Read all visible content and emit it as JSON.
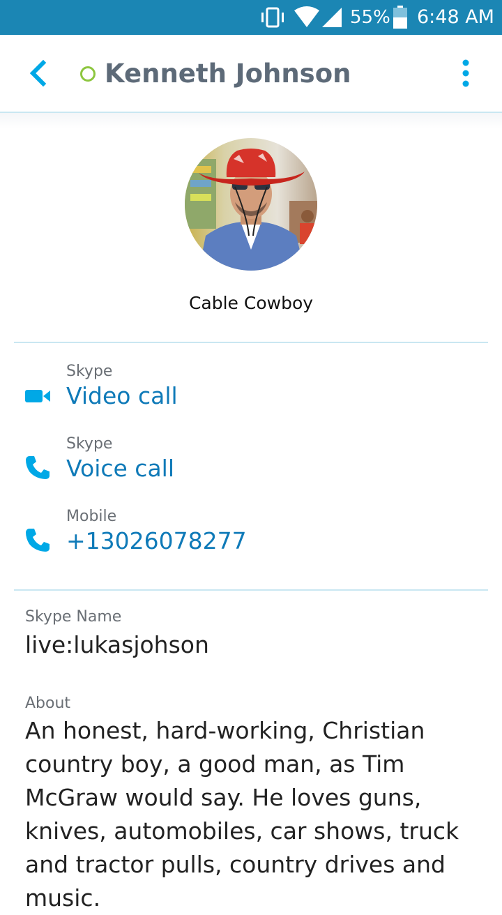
{
  "status_bar": {
    "battery_percent": "55%",
    "time": "6:48 AM",
    "icons": [
      "vibrate-icon",
      "wifi-icon",
      "signal-icon",
      "battery-icon"
    ]
  },
  "header": {
    "title": "Kenneth Johnson",
    "presence": "offline",
    "accent_color": "#00a8e6",
    "presence_color": "#8dc63f"
  },
  "profile": {
    "mood": "Cable Cowboy"
  },
  "contact_methods": [
    {
      "label": "Skype",
      "value": "Video call",
      "icon": "video-camera-icon"
    },
    {
      "label": "Skype",
      "value": "Voice call",
      "icon": "phone-icon"
    },
    {
      "label": "Mobile",
      "value": "+13026078277",
      "icon": "phone-icon"
    }
  ],
  "details": {
    "skype_name_label": "Skype Name",
    "skype_name": "live:lukasjohson",
    "about_label": "About",
    "about_text": "An honest, hard-working, Christian country boy, a good man, as Tim McGraw would say. He loves guns, knives, automobiles, car shows, truck and tractor pulls, country drives and music."
  }
}
